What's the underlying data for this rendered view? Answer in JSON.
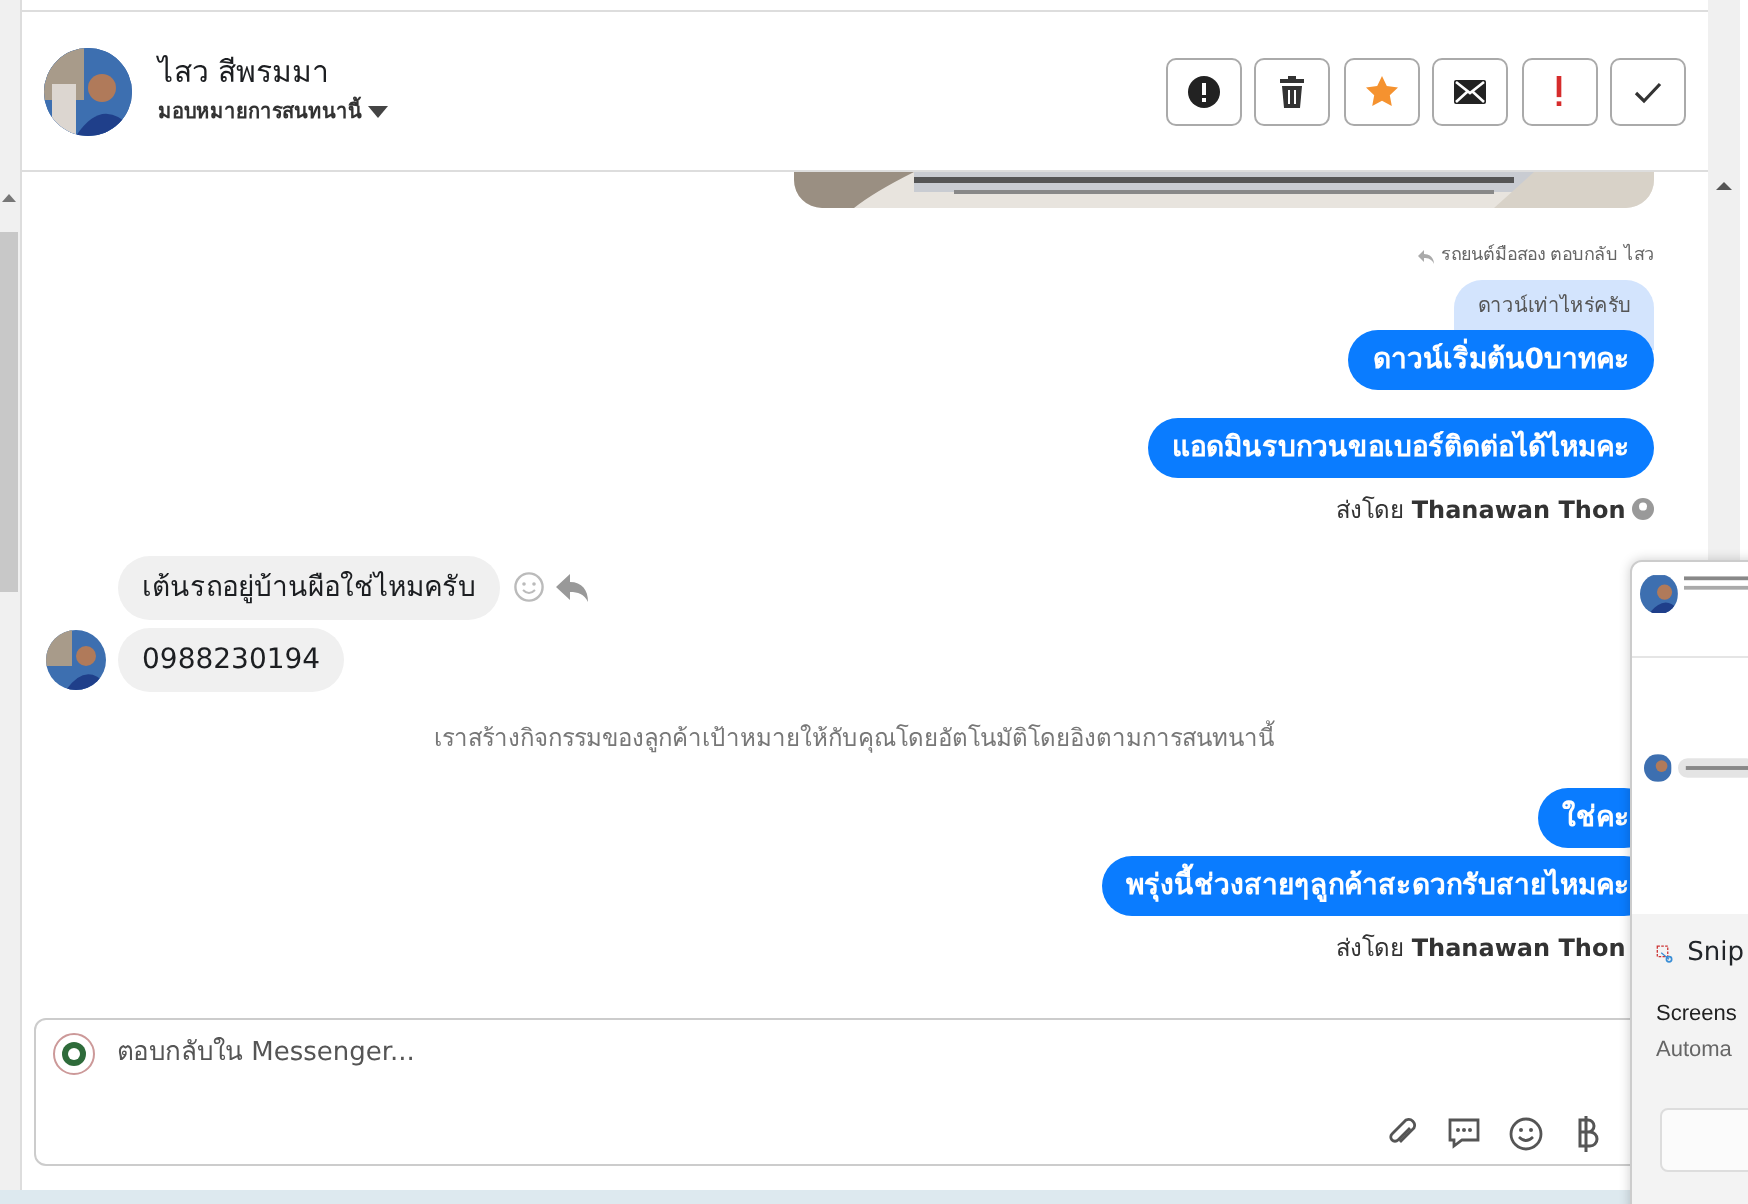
{
  "header": {
    "name": "ไสว สีพรมมา",
    "subtitle": "มอบหมายการสนทนานี้"
  },
  "actions": [
    {
      "kind": "alert"
    },
    {
      "kind": "trash"
    },
    {
      "kind": "star"
    },
    {
      "kind": "mail"
    },
    {
      "kind": "exclaim"
    },
    {
      "kind": "check"
    }
  ],
  "messages": [
    {
      "kind": "picture"
    },
    {
      "kind": "reply_context",
      "text": "รถยนต์มือสอง ตอบกลับ ไสว"
    },
    {
      "kind": "outgoing",
      "quote": "ดาวน์เท่าไหร่ครับ",
      "text": "ดาวน์เริ่มต้น0บาทคะ"
    },
    {
      "kind": "outgoing",
      "text": "แอดมินรบกวนขอเบอร์ติดต่อได้ไหมคะ"
    },
    {
      "kind": "sent_by",
      "prefix": "ส่งโดย",
      "sender": "Thanawan Thon",
      "seen": true
    },
    {
      "kind": "incoming",
      "text": "เต้นรถอยู่บ้านผือใช่ไหมครับ",
      "avatar": false,
      "tools": true
    },
    {
      "kind": "incoming",
      "text": "0988230194",
      "avatar": true,
      "tools": false
    },
    {
      "kind": "system",
      "text": "เราสร้างกิจกรรมของลูกค้าเป้าหมายให้กับคุณโดยอัตโนมัติโดยอิงตามการสนทนานี้"
    },
    {
      "kind": "outgoing",
      "text": "ใช่คะ"
    },
    {
      "kind": "outgoing",
      "text": "พรุ่งนี้ช่วงสายๆลูกค้าสะดวกรับสายไหมคะ"
    },
    {
      "kind": "sent_by",
      "prefix": "ส่งโดย",
      "sender": "Thanawan Thon"
    }
  ],
  "composer": {
    "placeholder": "ตอบกลับใน Messenger..."
  },
  "notification": {
    "app": "Snip",
    "lines": [
      "Screens",
      "Automa"
    ]
  }
}
